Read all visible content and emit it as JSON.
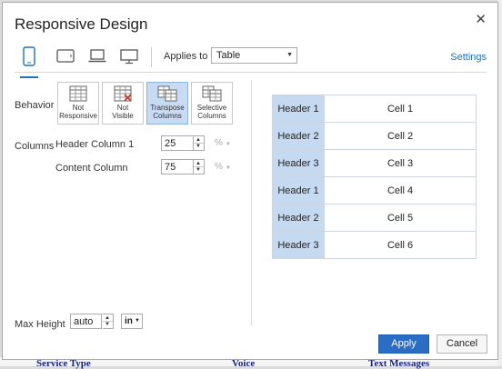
{
  "dialog": {
    "title": "Responsive Design",
    "close_glyph": "✕"
  },
  "toolbar": {
    "devices": [
      {
        "name": "phone-icon",
        "active": true
      },
      {
        "name": "tablet-icon",
        "active": false
      },
      {
        "name": "laptop-icon",
        "active": false
      },
      {
        "name": "desktop-icon",
        "active": false
      }
    ],
    "applies_to_label": "Applies to",
    "applies_to_value": "Table",
    "settings_label": "Settings"
  },
  "behavior": {
    "label": "Behavior",
    "options": [
      {
        "line1": "Not",
        "line2": "Responsive",
        "selected": false
      },
      {
        "line1": "Not",
        "line2": "Visible",
        "selected": false
      },
      {
        "line1": "Transpose",
        "line2": "Columns",
        "selected": true
      },
      {
        "line1": "Selective",
        "line2": "Columns",
        "selected": false
      }
    ]
  },
  "columns": {
    "label": "Columns",
    "header_column_label": "Header Column 1",
    "header_column_value": "25",
    "header_column_unit": "%",
    "content_column_label": "Content Column",
    "content_column_value": "75",
    "content_column_unit": "%"
  },
  "max_height": {
    "label": "Max Height",
    "value": "auto",
    "unit": "in"
  },
  "preview": {
    "rows": [
      {
        "header": "Header 1",
        "cell": "Cell 1"
      },
      {
        "header": "Header 2",
        "cell": "Cell 2"
      },
      {
        "header": "Header 3",
        "cell": "Cell 3"
      },
      {
        "header": "Header 1",
        "cell": "Cell 4"
      },
      {
        "header": "Header 2",
        "cell": "Cell 5"
      },
      {
        "header": "Header 3",
        "cell": "Cell 6"
      }
    ]
  },
  "buttons": {
    "apply": "Apply",
    "cancel": "Cancel"
  },
  "background": {
    "bottom_texts": [
      "Service Type",
      "Voice",
      "Text Messages"
    ]
  },
  "colors": {
    "accent": "#2b6cc4",
    "header_cell_bg": "#c5d9f1",
    "selected_option_bg": "#c7dbf3"
  }
}
